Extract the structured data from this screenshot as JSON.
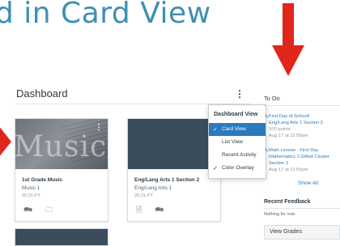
{
  "headline": "d in Card View",
  "dashboard": {
    "title": "Dashboard",
    "options_icon": "vertical-dots-icon"
  },
  "cards": [
    {
      "name": "1st Grade Music",
      "code": "Music 1",
      "term": "20-21-FY",
      "hero_text": "Music",
      "color": "#3b4d5c"
    },
    {
      "name": "Eng/Lang Arts 1 Section 2",
      "code": "Eng/Lang Arts 1",
      "term": "20-21-FY",
      "color": "#3b4d5c"
    }
  ],
  "menu": {
    "header": "Dashboard View",
    "items": [
      {
        "label": "Card View",
        "checked": true,
        "selected": true
      },
      {
        "label": "List View",
        "checked": false,
        "selected": false
      },
      {
        "label": "Recent Activity",
        "checked": false,
        "selected": false
      },
      {
        "label": "Color Overlay",
        "checked": true,
        "selected": false
      }
    ]
  },
  "todo": {
    "title": "To Do",
    "items": [
      {
        "title": "First Day of School!",
        "course": "Eng/Lang Arts 1 Section 2",
        "points": "100 points",
        "due": "Aug 17 at 11:59pm"
      },
      {
        "title": "Math Lesson - First Day",
        "course": "Mathematics 1 Gifted Cluster Section 2",
        "due": "Aug 17 at 11:59pm"
      }
    ],
    "show_all": "Show All"
  },
  "recent_feedback": {
    "title": "Recent Feedback",
    "empty": "Nothing for now"
  },
  "view_grades": "View Grades",
  "colors": {
    "accent": "#2b7abc",
    "arrow": "#e0261b",
    "headline": "#3f8fb0"
  }
}
